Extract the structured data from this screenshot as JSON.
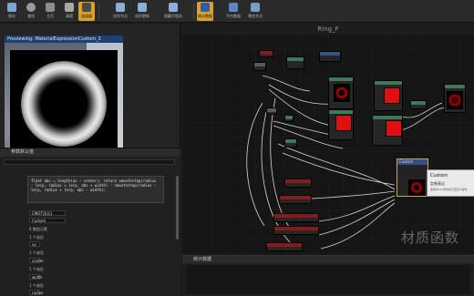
{
  "toolbar": {
    "buttons": [
      {
        "label": "保存",
        "icon": "save-icon"
      },
      {
        "label": "查找",
        "icon": "find-icon"
      },
      {
        "label": "主页",
        "icon": "home-icon"
      },
      {
        "label": "清理",
        "icon": "clean-icon"
      },
      {
        "label": "连接器",
        "icon": "connectors-icon"
      },
      {
        "label": "实时节点",
        "icon": "live-nodes-icon"
      },
      {
        "label": "实时更新",
        "icon": "live-update-icon"
      },
      {
        "label": "隐藏不相关",
        "icon": "hide-unrelated-icon"
      },
      {
        "label": "统计数据",
        "icon": "stats-icon"
      },
      {
        "label": "平台数据",
        "icon": "platform-stats-icon"
      },
      {
        "label": "预览节点",
        "icon": "preview-node-icon"
      }
    ]
  },
  "preview": {
    "title": "Previewing: MaterialExpressionCustom_2"
  },
  "details": {
    "header": "参数默认值",
    "code": "float abc = length(uv - center);\nreturn smoothstep(radius - lerp, radius + lerp, abc + width) - smoothstep(radius - lerp, radius + lerp, abc - width);",
    "output_type": "CMOT浮点1",
    "description": "Custom",
    "inputs_label": "0 数组元素",
    "items": [
      {
        "index": "1 个成员",
        "value": "uv"
      },
      {
        "index": "1 个成员",
        "value": "center"
      },
      {
        "index": "1 个成员",
        "value": "width"
      },
      {
        "index": "1 个成员",
        "value": "radius"
      }
    ]
  },
  "graph": {
    "title": "Ring_F",
    "custom_node_title": "Custom",
    "tooltip": {
      "title": "Custom",
      "line1": "定制表达",
      "line2": "使用HLSL代码执行自定义操作"
    }
  },
  "watermark": "材质函数",
  "stats": {
    "header": "统计数据"
  },
  "colors": {
    "accent": "#d6a12d",
    "preview_title_bg": "#1e3f74",
    "swatch_red": "#e01010"
  }
}
